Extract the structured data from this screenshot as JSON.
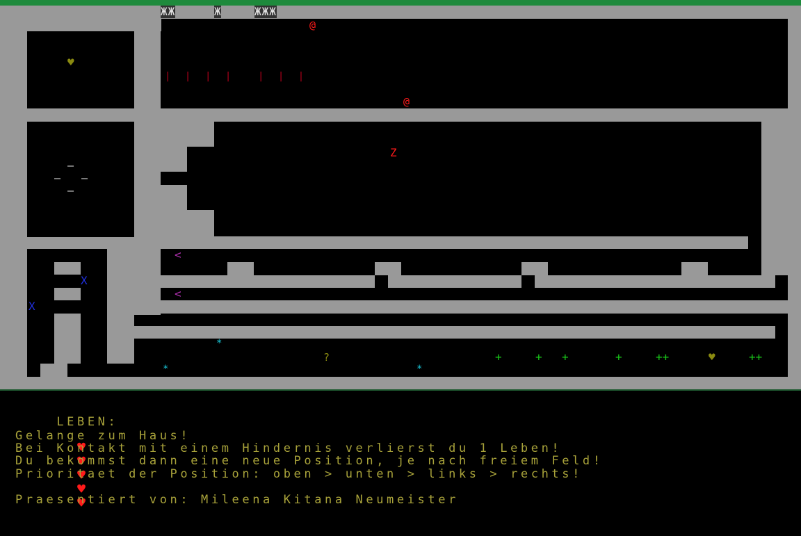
{
  "colors": {
    "wall": "#999999",
    "floor": "#000000",
    "text": "#a8a23a",
    "heart_hud": "#ff1a1a",
    "player": "#ff1a1a",
    "enemy_z": "#ff1a1a",
    "star": "#19c6d8",
    "plus": "#19c619",
    "x": "#2030e0",
    "arrow": "#b030b0",
    "heart_field": "#8a8a10",
    "bars": "#b2001a",
    "titlebar": "#1e8a3c"
  },
  "field": {
    "top_blocks": [
      "ЖЖ",
      "Ж",
      "ЖЖЖ"
    ],
    "at_signs": [
      "@",
      "@"
    ],
    "bars": [
      "| |",
      "| |",
      "| | |"
    ],
    "z": "Z",
    "question": "?",
    "x_marks": [
      "X",
      "X"
    ],
    "arrows": [
      "<",
      "<"
    ],
    "stars": [
      "*",
      "*",
      "*"
    ],
    "pluses": [
      "+",
      "+",
      "+",
      "+",
      "++",
      "++"
    ],
    "hearts": [
      "♥",
      "♥"
    ],
    "dash_pattern": [
      "—",
      "—",
      "—",
      "—"
    ]
  },
  "hud": {
    "lives_label": "LEBEN:",
    "lives": [
      "♥",
      "♥",
      "♥",
      "♥",
      "♥"
    ],
    "lines": [
      "Gelange zum Haus!",
      "Bei Kontakt mit einem Hindernis verlierst du 1 Leben!",
      "Du bekommst dann eine neue Position, je nach freiem Feld!",
      "Prioritaet der Position: oben > unten > links > rechts!"
    ],
    "credit": "Praesentiert von: Mileena Kitana Neumeister"
  }
}
